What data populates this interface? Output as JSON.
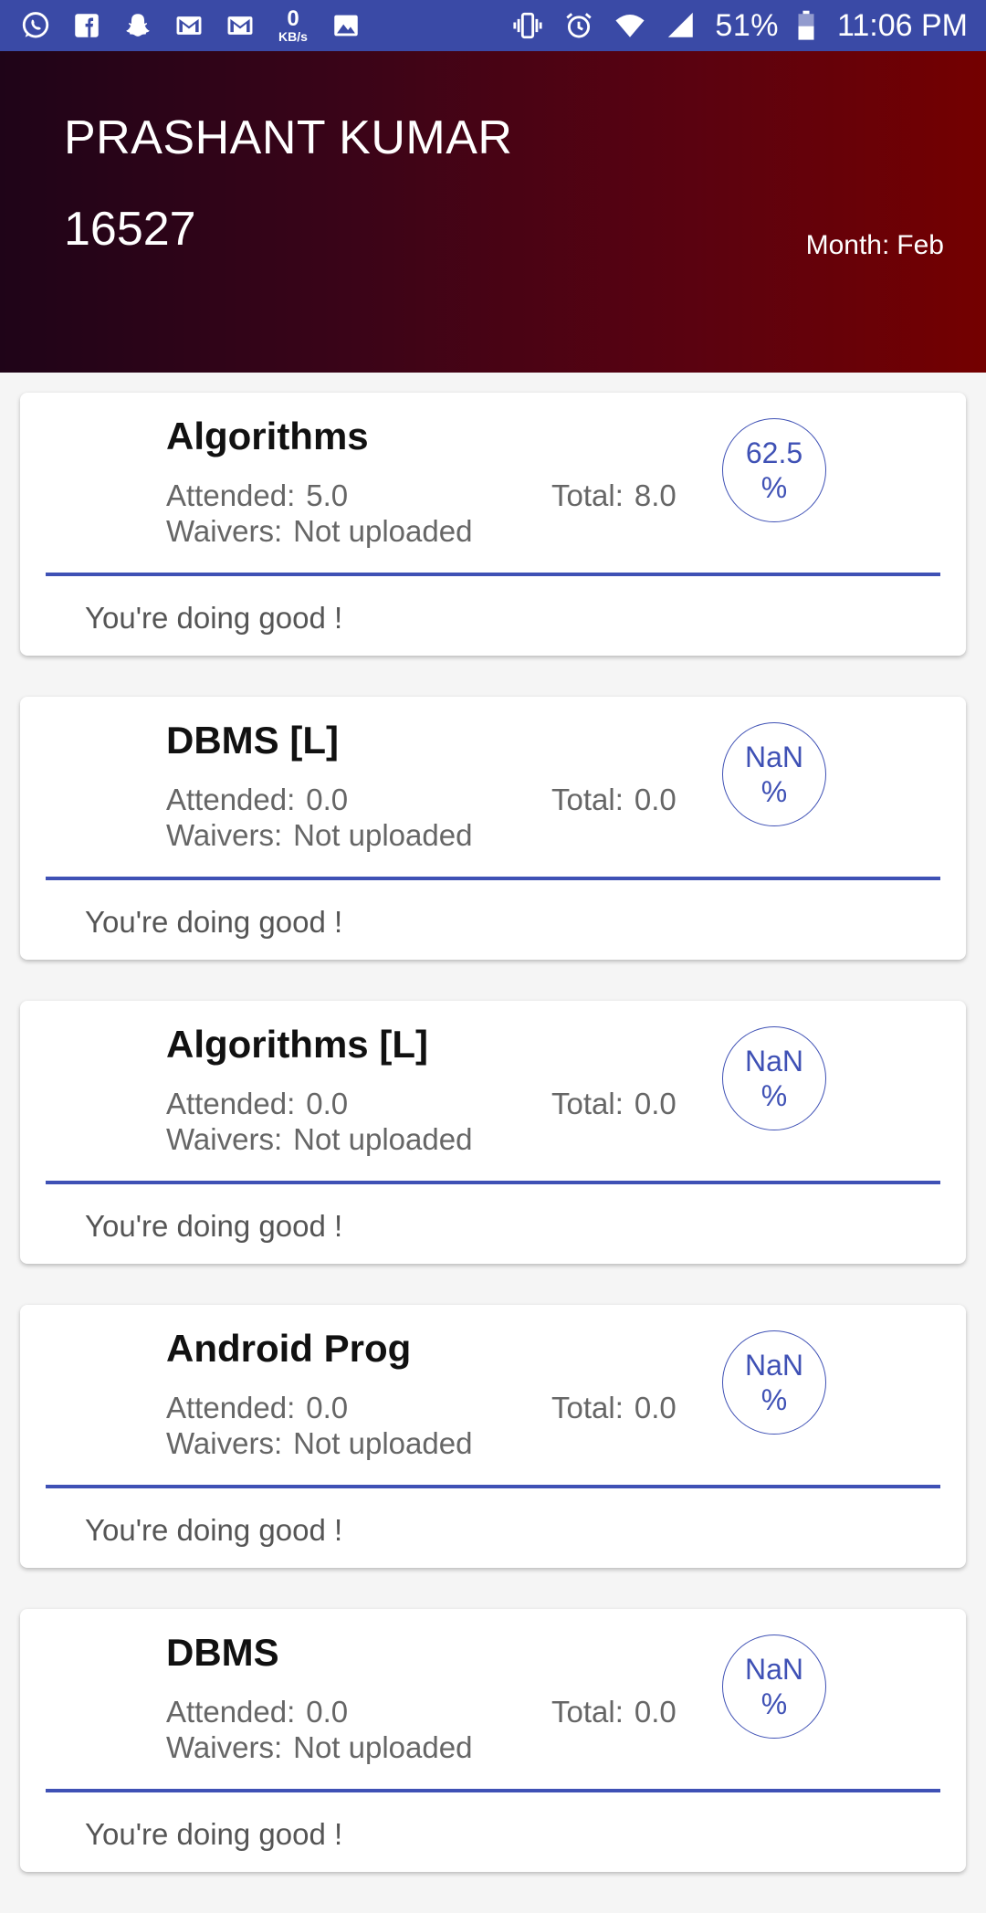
{
  "status_bar": {
    "left_icons": [
      "whatsapp-icon",
      "facebook-icon",
      "snapchat-icon",
      "gmail-icon",
      "gmail-icon",
      "image-icon"
    ],
    "net_speed_value": "0",
    "net_speed_unit": "KB/s",
    "right_icons": [
      "vibrate-icon",
      "alarm-icon",
      "wifi-icon",
      "cell-signal-icon",
      "battery-icon"
    ],
    "battery": "51%",
    "time": "11:06 PM"
  },
  "header": {
    "name": "PRASHANT KUMAR",
    "id": "16527",
    "month_label": "Month:",
    "month_value": "Feb"
  },
  "labels": {
    "attended": "Attended:",
    "total": "Total:",
    "waivers": "Waivers:",
    "percent_sign": "%"
  },
  "courses": [
    {
      "name": "Algorithms",
      "attended": "5.0",
      "total": "8.0",
      "waivers": "Not uploaded",
      "percentage": "62.5",
      "remark": "You're doing good !"
    },
    {
      "name": "DBMS [L]",
      "attended": "0.0",
      "total": "0.0",
      "waivers": "Not uploaded",
      "percentage": "NaN",
      "remark": "You're doing good !"
    },
    {
      "name": "Algorithms [L]",
      "attended": "0.0",
      "total": "0.0",
      "waivers": "Not uploaded",
      "percentage": "NaN",
      "remark": "You're doing good !"
    },
    {
      "name": "Android Prog",
      "attended": "0.0",
      "total": "0.0",
      "waivers": "Not uploaded",
      "percentage": "NaN",
      "remark": "You're doing good !"
    },
    {
      "name": "DBMS",
      "attended": "0.0",
      "total": "0.0",
      "waivers": "Not uploaded",
      "percentage": "NaN",
      "remark": "You're doing good !"
    }
  ],
  "colors": {
    "status_bar": "#3a4aa6",
    "accent": "#3f51b5",
    "header_start": "#1f0418",
    "header_end": "#740000"
  }
}
